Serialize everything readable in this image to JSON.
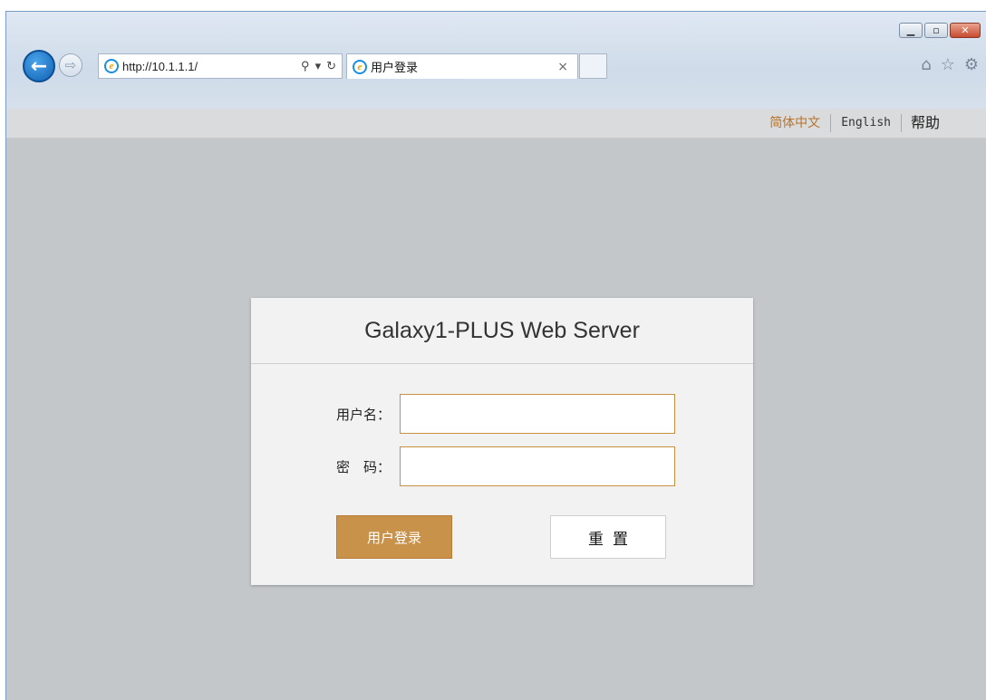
{
  "browser": {
    "address_url": "http://10.1.1.1/",
    "search_icon": "search-icon",
    "tab_title": "用户登录",
    "tab_close": "×",
    "window_controls": {
      "minimize": "▁",
      "maximize": "▫",
      "close": "✕"
    },
    "tools": {
      "home": "⌂",
      "favorites": "☆",
      "settings": "⚙"
    }
  },
  "langbar": {
    "chinese": "简体中文",
    "english": "English",
    "help": "帮助"
  },
  "login": {
    "title": "Galaxy1-PLUS Web Server",
    "username_label": "用户名：",
    "password_label": "密　码：",
    "username_value": "",
    "password_value": "",
    "login_button": "用户登录",
    "reset_button": "重置"
  },
  "colors": {
    "accent": "#c9924a",
    "lang_active": "#b8732d",
    "page_bg": "#c3c7ca"
  }
}
